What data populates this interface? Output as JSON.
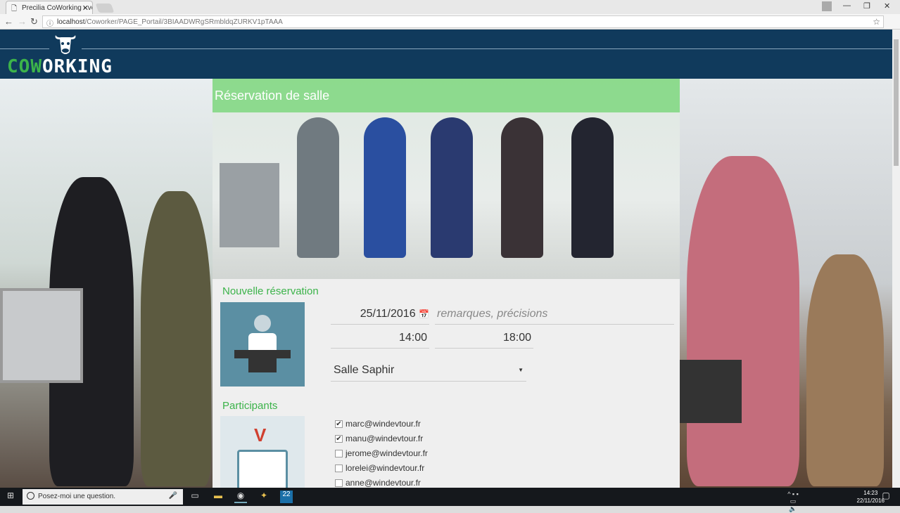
{
  "browser": {
    "tab_title": "Precilia CoWorking - vot",
    "url_host": "localhost",
    "url_path": "/Coworker/PAGE_Portail/3BIAADWRgSRmbldqZURKV1pTAAA"
  },
  "header": {
    "logo_co": "CO",
    "logo_wo": "W",
    "logo_rest": "ORKING"
  },
  "banner": {
    "title": "Réservation de salle"
  },
  "reservation": {
    "heading": "Nouvelle réservation",
    "date": "25/11/2016",
    "remarks_placeholder": "remarques, précisions",
    "start_time": "14:00",
    "end_time": "18:00",
    "room": "Salle Saphir"
  },
  "participants": {
    "heading": "Participants",
    "items": [
      {
        "email": "marc@windevtour.fr",
        "checked": true
      },
      {
        "email": "manu@windevtour.fr",
        "checked": true
      },
      {
        "email": "jerome@windevtour.fr",
        "checked": false
      },
      {
        "email": "lorelei@windevtour.fr",
        "checked": false
      },
      {
        "email": "anne@windevtour.fr",
        "checked": false
      }
    ]
  },
  "taskbar": {
    "search_placeholder": "Posez-moi une question.",
    "time": "14:23",
    "date": "22/11/2016"
  },
  "colors": {
    "header": "#103a5c",
    "accent": "#3cb34a"
  }
}
